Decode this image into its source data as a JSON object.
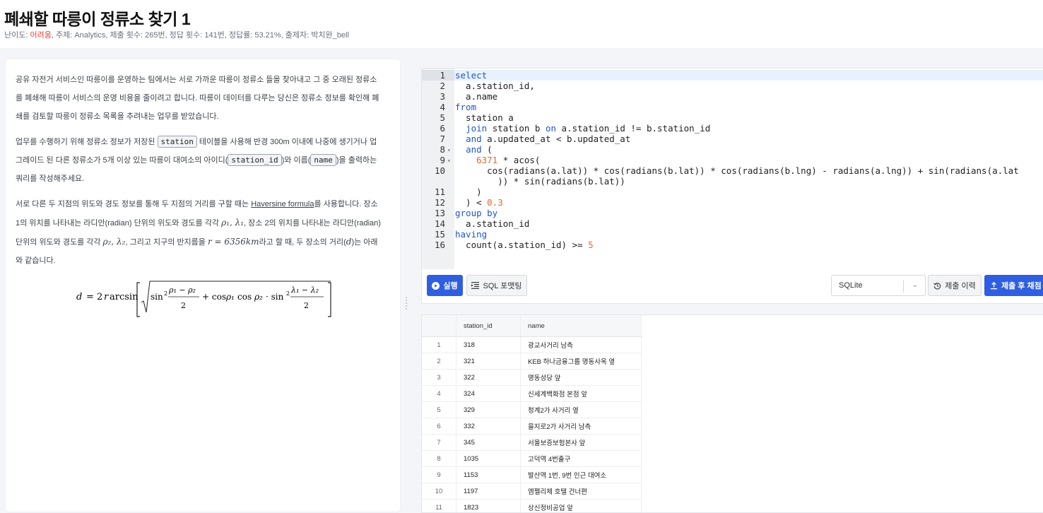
{
  "page": {
    "title": "폐쇄할 따릉이 정류소 찾기 1",
    "meta": {
      "difficulty_label": "난이도:",
      "difficulty": "어려움",
      "rest": ", 주제: Analytics, 제출 횟수: 265번, 정답 횟수: 141번, 정답률: 53.21%, 출제자: 박치완_bell"
    }
  },
  "problem": {
    "p1": "공유 자전거 서비스인 따릉이를 운영하는 팀에서는 서로 가까운 따릉이 정류소 들을 찾아내고 그 중 오래된 정류소를 폐쇄해 따릉이 서비스의 운영 비용을 줄이려고 합니다. 따릉이 데이터를 다루는 당신은 정류소 정보를 확인해 폐쇄를 검토할 따릉이 정류소 목록을 추려내는 업무를 받았습니다.",
    "p2a": "업무를 수행하기 위해 정류소 정보가 저장된 ",
    "p2_code1": "station",
    "p2b": " 테이블을 사용해 반경 300m 이내에 나중에 생기거나 업그레이드 된 다른 정류소가 5개 이상 있는 따릉이 대여소의 아이디(",
    "p2_code2": "station_id",
    "p2c": ")와 이름(",
    "p2_code3": "name",
    "p2d": ")을 출력하는 쿼리를 작성해주세요.",
    "p3a": "서로 다른 두 지점의 위도와 경도 정보를 통해 두 지점의 거리를 구할 때는 ",
    "p3_link": "Haversine formula",
    "p3b": "를 사용합니다. 장소 1의 위치를 나타내는 라디안(radian) 단위의 위도와 경도를 각각 ",
    "p3_m1": "ρ₁, λ₁",
    "p3c": ", 장소 2의 위치를 나타내는 라디안(radian) 단위의 위도와 경도를 각각 ",
    "p3_m2": "ρ₂, λ₂",
    "p3d": ", 그리고 지구의 반지름을 ",
    "p3_m3": "r = 6356km",
    "p3e": "라고 할 때, 두 장소의 거리(",
    "p3_m4": "d",
    "p3f": ")는 아래와 같습니다."
  },
  "editor": {
    "lines": [
      {
        "n": "1",
        "html": "<span class='kw'>select</span>"
      },
      {
        "n": "2",
        "html": "  a.station_id,"
      },
      {
        "n": "3",
        "html": "  a.name"
      },
      {
        "n": "4",
        "html": "<span class='kw'>from</span>"
      },
      {
        "n": "5",
        "html": "  station a"
      },
      {
        "n": "6",
        "html": "  <span class='kw'>join</span> station b <span class='kw'>on</span> a.station_id != b.station_id"
      },
      {
        "n": "7",
        "html": "  <span class='kw'>and</span> a.updated_at &lt; b.updated_at"
      },
      {
        "n": "8",
        "html": "  <span class='kw'>and</span> (",
        "fold": true
      },
      {
        "n": "9",
        "html": "    <span class='num'>6371</span> * acos(",
        "fold": true
      },
      {
        "n": "10",
        "html": "      cos(radians(a.lat)) * cos(radians(b.lat)) * cos(radians(b.lng) - radians(a.lng)) + sin(radians(a.lat"
      },
      {
        "n": "",
        "html": "        )) * sin(radians(b.lat))"
      },
      {
        "n": "11",
        "html": "    )"
      },
      {
        "n": "12",
        "html": "  ) &lt; <span class='num'>0.3</span>"
      },
      {
        "n": "13",
        "html": "<span class='kw'>group by</span>"
      },
      {
        "n": "14",
        "html": "  a.station_id"
      },
      {
        "n": "15",
        "html": "<span class='kw'>having</span>"
      },
      {
        "n": "16",
        "html": "  count(a.station_id) &gt;= <span class='num'>5</span>"
      }
    ]
  },
  "toolbar": {
    "run_label": "실행",
    "format_label": "SQL 포맷팅",
    "dialect_value": "SQLite",
    "history_label": "제출 이력",
    "submit_label": "제출 후 채점"
  },
  "results": {
    "columns": [
      "",
      "station_id",
      "name"
    ],
    "rows": [
      [
        "1",
        "318",
        "광교사거리 남측"
      ],
      [
        "2",
        "321",
        "KEB 하나금융그룹 명동사옥 옆"
      ],
      [
        "3",
        "322",
        "명동성당 앞"
      ],
      [
        "4",
        "324",
        "신세계백화점 본점 앞"
      ],
      [
        "5",
        "329",
        "청계2가 사거리 옆"
      ],
      [
        "6",
        "332",
        "을지로2가 사거리 남측"
      ],
      [
        "7",
        "345",
        "서울보증보험본사 앞"
      ],
      [
        "8",
        "1035",
        "고덕역 4번출구"
      ],
      [
        "9",
        "1153",
        "발산역 1번, 9번 인근 대여소"
      ],
      [
        "10",
        "1197",
        "엠펠리체 호텔 건너편"
      ],
      [
        "11",
        "1823",
        "상신정비공업 앞"
      ]
    ]
  }
}
